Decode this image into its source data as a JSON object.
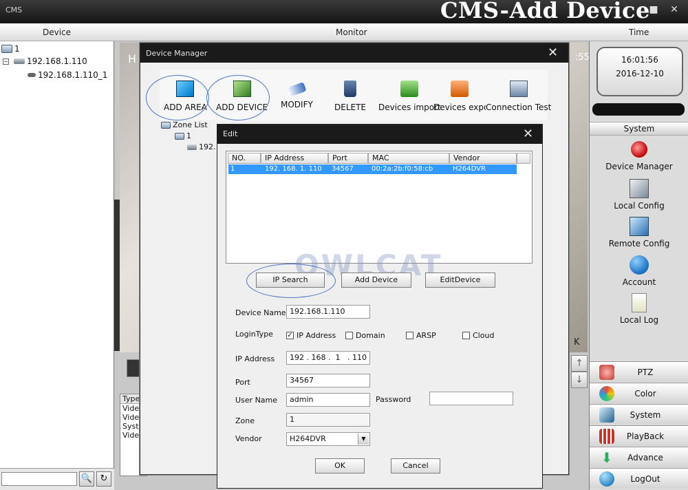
{
  "window": {
    "app_name": "CMS",
    "banner": "CMS-Add Device",
    "minimize_glyph": "■",
    "close_glyph": "✕"
  },
  "columns": {
    "device": "Device",
    "monitor": "Monitor",
    "time": "Time"
  },
  "device_tree": {
    "root": "1",
    "device": "192.168.1.110",
    "channel": "192.168.1.110_1",
    "collapse_glyph": "−"
  },
  "left_footer": {
    "search_placeholder": "",
    "search_glyph": "🔍",
    "refresh_glyph": "↻"
  },
  "monitor": {
    "video_letter": "H",
    "video_suffix": ":55",
    "side_letters": "K",
    "up_glyph": "↑",
    "down_glyph": "↓",
    "log_header": "Type",
    "log_rows": [
      "Video",
      "Video",
      "Syste",
      "Video"
    ]
  },
  "clock": {
    "time": "16:01:56",
    "date": "2016-12-10"
  },
  "system_panel": {
    "title": "System",
    "items": [
      {
        "label": "Device Manager",
        "icon": "device-manager-icon"
      },
      {
        "label": "Local Config",
        "icon": "local-config-icon"
      },
      {
        "label": "Remote Config",
        "icon": "remote-config-icon"
      },
      {
        "label": "Account",
        "icon": "account-icon"
      },
      {
        "label": "Local Log",
        "icon": "local-log-icon"
      }
    ],
    "buttons": [
      {
        "label": "PTZ",
        "color": "#c0392b"
      },
      {
        "label": "Color",
        "color": "#2e86c1"
      },
      {
        "label": "System",
        "color": "#1f618d"
      },
      {
        "label": "PlayBack",
        "color": "#c0392b"
      },
      {
        "label": "Advance",
        "color": "#27ae60"
      },
      {
        "label": "LogOut",
        "color": "#2e86c1"
      }
    ]
  },
  "device_manager": {
    "title": "Device Manager",
    "close_glyph": "✕",
    "toolbar": [
      {
        "label": "ADD AREA"
      },
      {
        "label": "ADD DEVICE"
      },
      {
        "label": "MODIFY"
      },
      {
        "label": "DELETE"
      },
      {
        "label": "Devices import"
      },
      {
        "label": "Devices expor"
      },
      {
        "label": "Connection  Test"
      }
    ],
    "zone_list": {
      "title": "Zone List",
      "zone": "1",
      "device": "192."
    }
  },
  "edit": {
    "title": "Edit",
    "close_glyph": "✕",
    "grid": {
      "headers": [
        "NO.",
        "IP Address",
        "Port",
        "MAC",
        "Vendor"
      ],
      "rows": [
        {
          "no": "1",
          "ip": "192. 168. 1. 110",
          "port": "34567",
          "mac": "00:2a:2b:f0:58:cb",
          "vendor": "H264DVR"
        }
      ]
    },
    "buttons": {
      "ip_search": "IP Search",
      "add_device": "Add Device",
      "edit_device": "EditDevice",
      "ok": "OK",
      "cancel": "Cancel"
    },
    "watermark": "OWLCAT",
    "form": {
      "device_name_label": "Device Name",
      "device_name": "192.168.1.110",
      "login_type_label": "LoginType",
      "login_options": [
        {
          "label": "IP Address",
          "checked": "✓"
        },
        {
          "label": "Domain",
          "checked": ""
        },
        {
          "label": "ARSP",
          "checked": ""
        },
        {
          "label": "Cloud",
          "checked": ""
        }
      ],
      "ip_label": "IP Address",
      "ip_value": "192 . 168 .  1   . 110",
      "port_label": "Port",
      "port": "34567",
      "user_label": "User Name",
      "user": "admin",
      "password_label": "Password",
      "password": "",
      "zone_label": "Zone",
      "zone": "1",
      "vendor_label": "Vendor",
      "vendor": "H264DVR",
      "dropdown_glyph": "▼"
    }
  }
}
